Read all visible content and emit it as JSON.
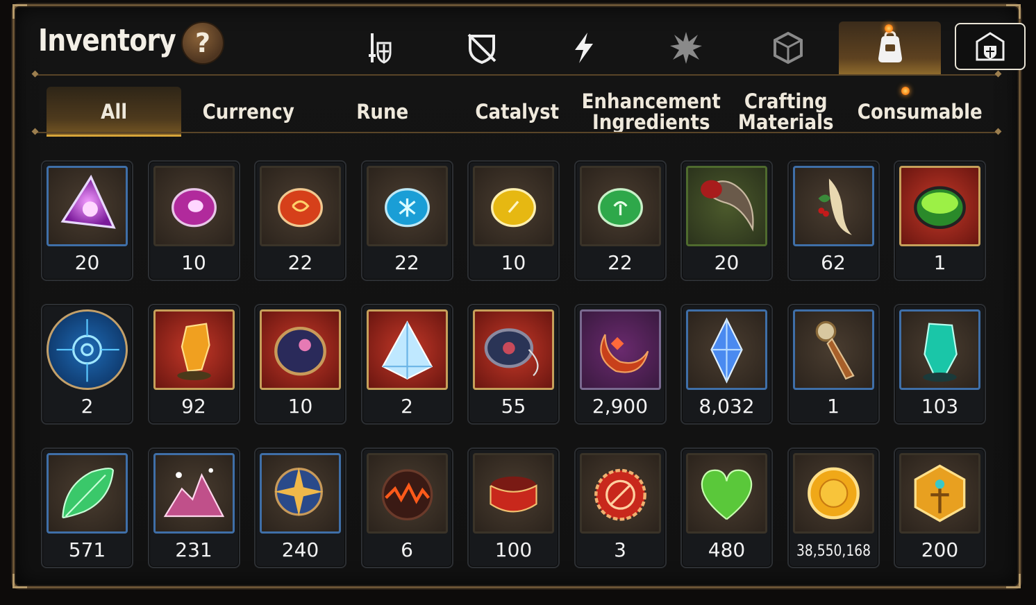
{
  "header": {
    "title": "Inventory",
    "help_label": "?"
  },
  "top_nav": [
    {
      "icon": "sword-shield-icon"
    },
    {
      "icon": "broken-shield-icon"
    },
    {
      "icon": "lightning-icon"
    },
    {
      "icon": "burst-spike-icon"
    },
    {
      "icon": "cube-icon"
    },
    {
      "icon": "backpack-icon",
      "active": true
    },
    {
      "icon": "guild-shield-icon"
    }
  ],
  "tabs": [
    {
      "label": "All",
      "active": true
    },
    {
      "label": "Currency"
    },
    {
      "label": "Rune"
    },
    {
      "label": "Catalyst"
    },
    {
      "label": "Enhancement\nIngredients"
    },
    {
      "label": "Crafting\nMaterials"
    },
    {
      "label": "Consumable"
    }
  ],
  "items": [
    {
      "icon": "purple-triangle-rune-icon",
      "count": "20"
    },
    {
      "icon": "purple-oval-rune-icon",
      "count": "10"
    },
    {
      "icon": "red-oval-rune-icon",
      "count": "22"
    },
    {
      "icon": "blue-oval-rune-icon",
      "count": "22"
    },
    {
      "icon": "yellow-oval-rune-icon",
      "count": "10"
    },
    {
      "icon": "green-oval-rune-icon",
      "count": "22"
    },
    {
      "icon": "beast-claw-icon",
      "count": "20"
    },
    {
      "icon": "ginseng-root-icon",
      "count": "62"
    },
    {
      "icon": "green-potion-bowl-icon",
      "count": "1"
    },
    {
      "icon": "blue-magic-circle-icon",
      "count": "2"
    },
    {
      "icon": "amber-crystal-icon",
      "count": "92"
    },
    {
      "icon": "cosmic-disc-icon",
      "count": "10"
    },
    {
      "icon": "triangle-crystal-icon",
      "count": "2"
    },
    {
      "icon": "pendant-disc-icon",
      "count": "55"
    },
    {
      "icon": "crescent-charm-icon",
      "count": "2,900"
    },
    {
      "icon": "blue-diamond-icon",
      "count": "8,032"
    },
    {
      "icon": "dagger-key-icon",
      "count": "1"
    },
    {
      "icon": "teal-crystal-icon",
      "count": "103"
    },
    {
      "icon": "green-leaf-icon",
      "count": "571"
    },
    {
      "icon": "pink-crystal-pile-icon",
      "count": "231"
    },
    {
      "icon": "star-compass-icon",
      "count": "240"
    },
    {
      "icon": "fire-orb-icon",
      "count": "6"
    },
    {
      "icon": "red-bracelet-icon",
      "count": "100"
    },
    {
      "icon": "red-seal-badge-icon",
      "count": "3"
    },
    {
      "icon": "green-heart-icon",
      "count": "480"
    },
    {
      "icon": "gold-coin-icon",
      "count": "38,550,168"
    },
    {
      "icon": "gold-emblem-icon",
      "count": "200"
    }
  ]
}
